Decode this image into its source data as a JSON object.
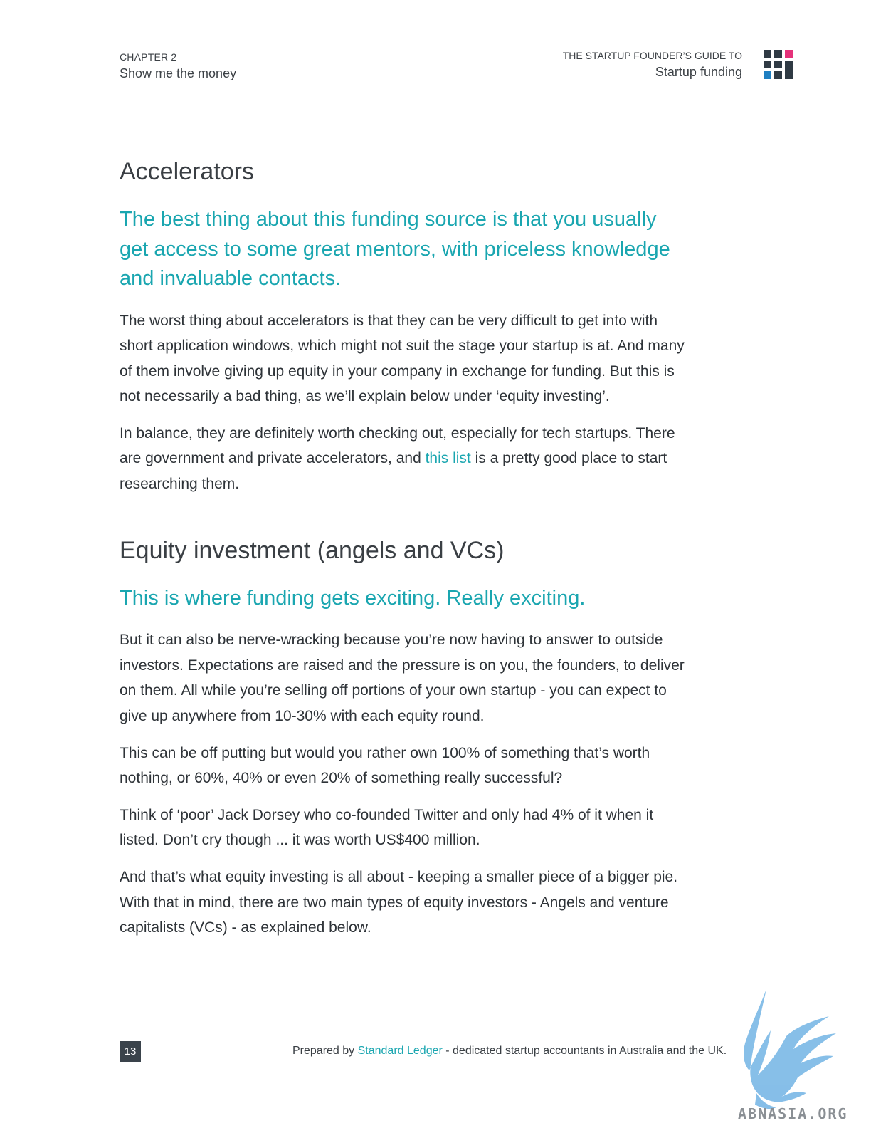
{
  "header": {
    "chapter_label": "CHAPTER 2",
    "chapter_title": "Show me the money",
    "guide_label": "THE STARTUP FOUNDER’S GUIDE TO",
    "guide_title": "Startup funding",
    "logo_icon": "grid-logo-icon",
    "logo_colors": {
      "dark": "#2f3a44",
      "pink": "#e5327a",
      "blue": "#1f7fc1"
    }
  },
  "sections": [
    {
      "heading": "Accelerators",
      "lead": "The best thing about this funding source is that you usually get access to some great mentors, with priceless knowledge and invaluable contacts.",
      "paragraphs": [
        "The worst thing about accelerators is that they can be very difficult to get into with short application windows, which might not suit the stage your startup is at. And many of them involve giving up equity in your company in exchange for funding. But this is not necessarily a bad thing, as we’ll explain below under ‘equity investing’."
      ],
      "link_paragraph": {
        "before": "In balance, they are definitely worth checking out, especially for tech startups. There are government and private accelerators, and ",
        "link": "this list",
        "after": " is a pretty good place to start researching them."
      }
    },
    {
      "heading": "Equity investment (angels and VCs)",
      "lead": "This is where funding gets exciting. Really exciting.",
      "paragraphs": [
        "But it can also be nerve-wracking because you’re now having to answer to outside investors.  Expectations are raised and the pressure is on you, the founders, to deliver on them. All while you’re selling off portions of your own startup - you can expect to give up anywhere from 10-30% with each equity round.",
        "This can be off putting but would you rather own 100% of something that’s worth nothing, or 60%, 40% or even 20% of something really successful?",
        "Think of ‘poor’ Jack Dorsey who co-founded Twitter and only had 4% of it when it listed. Don’t cry though ... it was worth US$400 million.",
        "And that’s what equity investing is all about - keeping a smaller piece of a bigger pie. With that in mind, there are two main types of equity investors - Angels and venture capitalists (VCs) - as explained below."
      ]
    }
  ],
  "footer": {
    "page_number": "13",
    "prepared_by": "Prepared by ",
    "company_link": "Standard Ledger",
    "tagline": " - dedicated startup accountants in Australia and the UK."
  },
  "watermark": {
    "icon": "griffin-watermark-icon",
    "text": "ABNASIA.ORG",
    "color": "#7ab8e6"
  },
  "colors": {
    "accent": "#1aa6b0",
    "text": "#2e3338"
  }
}
